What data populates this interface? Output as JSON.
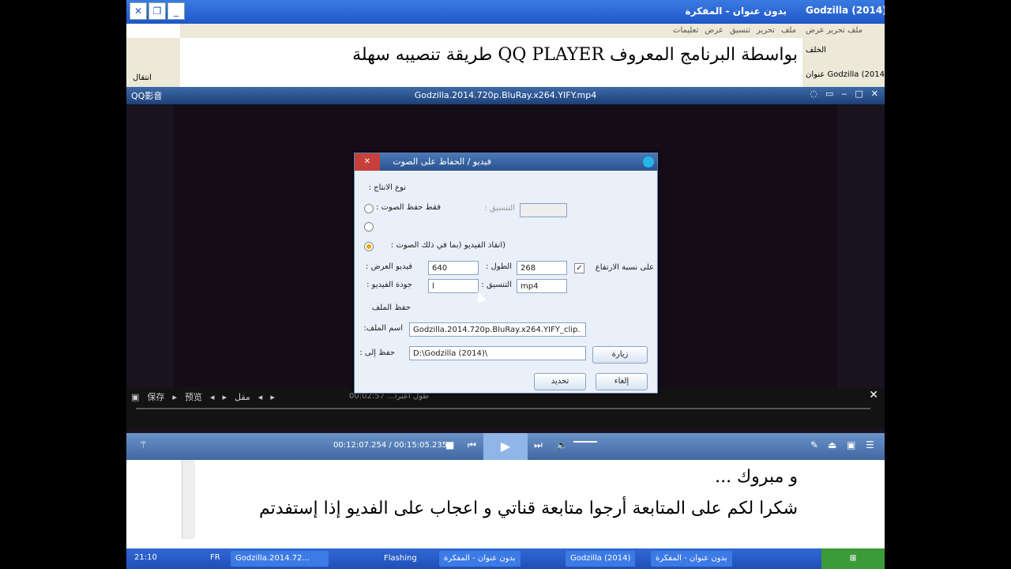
{
  "notepad": {
    "title": "بدون عنوان - المفكرة",
    "menu": [
      "ملف",
      "تحرير",
      "تنسيق",
      "عرض",
      "تعليمات"
    ],
    "text_line1": "بواسطة البرنامج المعروف QQ PLAYER طريقة تنصيبه سهلة",
    "text_line3": "و مبروك ...",
    "text_line4": "شكرا لكم على المتابعة أرجوا متابعة قناتي و اعجاب على الفديو إذا إستفدتم",
    "left_pane": "انتقال"
  },
  "explorer": {
    "title": "Godzilla (2014)",
    "menu": [
      "ملف",
      "تحرير",
      "عرض"
    ],
    "back_label": "الخلف",
    "address_label": "عنوان",
    "address_value": "Godzilla (2014)"
  },
  "player": {
    "logo": "QQ影音",
    "file_title": "Godzilla.2014.720p.BluRay.x264.YIFY.mp4",
    "edit_bar": {
      "save_label": "保存",
      "preview_label": "预览",
      "segment_label": "مقل",
      "time_text": "00:02:57 ...طول أعترا"
    },
    "timecode": "00:12:07.254 / 00:15:05.235"
  },
  "dialog": {
    "title": "فيديو / الحفاظ على الصوت",
    "section_output": "نوع الانتاج :",
    "audio_only": "فقط حفظ الصوت :",
    "format_label_disabled": "التنسيق :",
    "video_with_audio": "(انقاذ الفيديو (بما في ذلك الصوت :",
    "width_label": "فيديو العرض :",
    "width_value": "640",
    "height_label": "الطول :",
    "height_value": "268",
    "keep_ratio_label": "على نسبة الارتفاع",
    "quality_label": "جودة الفيديو :",
    "quality_value": "l",
    "format_label": "التنسيق :",
    "format_value": "mp4",
    "section_save": "حفظ الملف",
    "filename_label": "اسم الملف:",
    "filename_value": "Godzilla.2014.720p.BluRay.x264.YIFY_clip.",
    "save_to_label": "حفظ إلى :",
    "save_to_value": "D:\\Godzilla (2014)\\",
    "browse_button": "زيارة",
    "ok_button": "تحديد",
    "cancel_button": "إلغاء"
  },
  "taskbar": {
    "clock": "21:10",
    "lang": "FR",
    "items": [
      "Godzilla.2014.72...",
      "Flashing",
      "بدون عنوان - المفكرة",
      "Godzilla (2014)",
      "بدون عنوان - المفكرة"
    ]
  }
}
